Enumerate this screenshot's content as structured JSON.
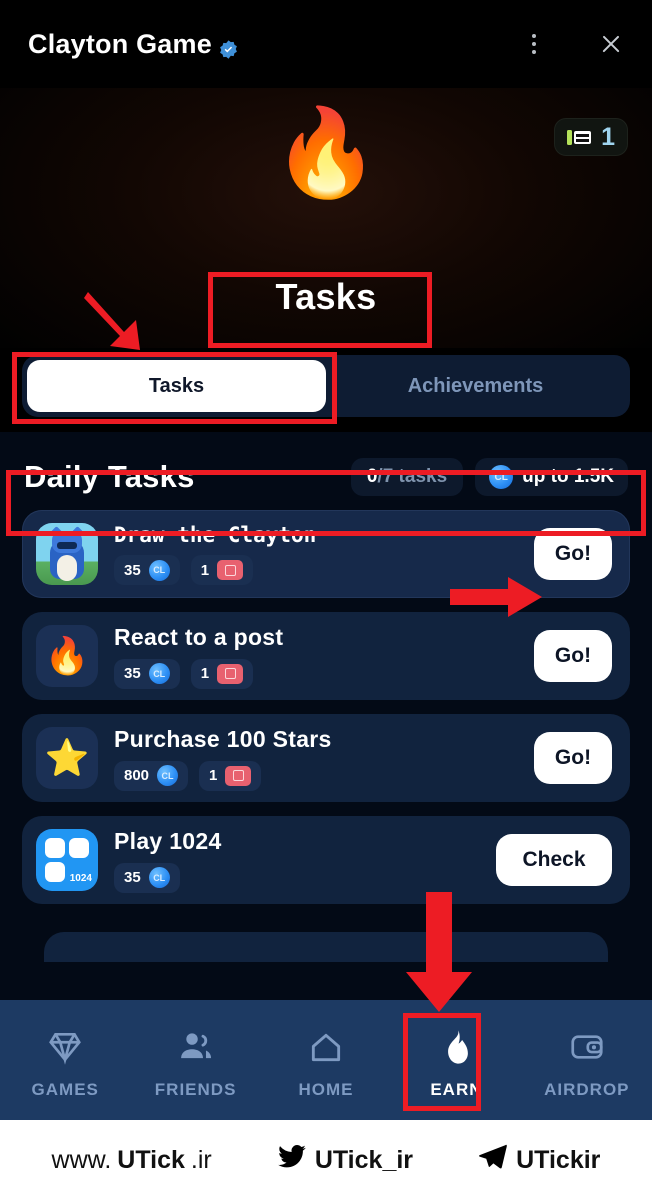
{
  "header": {
    "title": "Clayton Game",
    "verified_icon": "verified-badge-icon",
    "menu_icon": "more-vertical-icon",
    "close_icon": "close-icon"
  },
  "hero": {
    "flame_icon": "flame-emoji",
    "streak_value": "1",
    "streak_icon": "energy-battery-icon",
    "page_title": "Tasks"
  },
  "tabs": [
    {
      "label": "Tasks",
      "active": true
    },
    {
      "label": "Achievements",
      "active": false
    }
  ],
  "daily": {
    "title": "Daily Tasks",
    "progress_done": "0",
    "progress_rest": "/7 tasks",
    "reward_cap": "up to 1.5K",
    "coin_icon": "cl-coin-icon",
    "coin_label": "CL"
  },
  "tasks": [
    {
      "title": "Draw the Clayton",
      "icon": "clayton-character-icon",
      "coins": "35",
      "tickets": "1",
      "action": "Go!",
      "highlight": true
    },
    {
      "title": "React to a post",
      "icon": "flame-emoji",
      "emoji": "🔥",
      "coins": "35",
      "tickets": "1",
      "action": "Go!",
      "highlight": false
    },
    {
      "title": "Purchase 100 Stars",
      "icon": "star-emoji",
      "emoji": "⭐",
      "coins": "800",
      "tickets": "1",
      "action": "Go!",
      "highlight": false
    },
    {
      "title": "Play 1024",
      "icon": "game-1024-icon",
      "icon_label": "1024",
      "coins": "35",
      "tickets": null,
      "action": "Check",
      "highlight": false
    }
  ],
  "nav": [
    {
      "label": "GAMES",
      "icon": "diamond-icon",
      "active": false
    },
    {
      "label": "FRIENDS",
      "icon": "people-icon",
      "active": false
    },
    {
      "label": "HOME",
      "icon": "home-icon",
      "active": false
    },
    {
      "label": "EARN",
      "icon": "flame-icon",
      "active": true
    },
    {
      "label": "AIRDROP",
      "icon": "wallet-icon",
      "active": false
    }
  ],
  "watermark": {
    "site_prefix": "www.",
    "site_main": "UTick",
    "site_suffix": ".ir",
    "twitter_icon": "twitter-bird-icon",
    "twitter_handle": "UTick_ir",
    "telegram_icon": "telegram-plane-icon",
    "telegram_handle": "UTickir"
  },
  "colors": {
    "annotation": "#ed1c24",
    "accent_blue": "#2e90f5",
    "nav_bg": "#1d3a63",
    "card_bg": "#11233e"
  }
}
